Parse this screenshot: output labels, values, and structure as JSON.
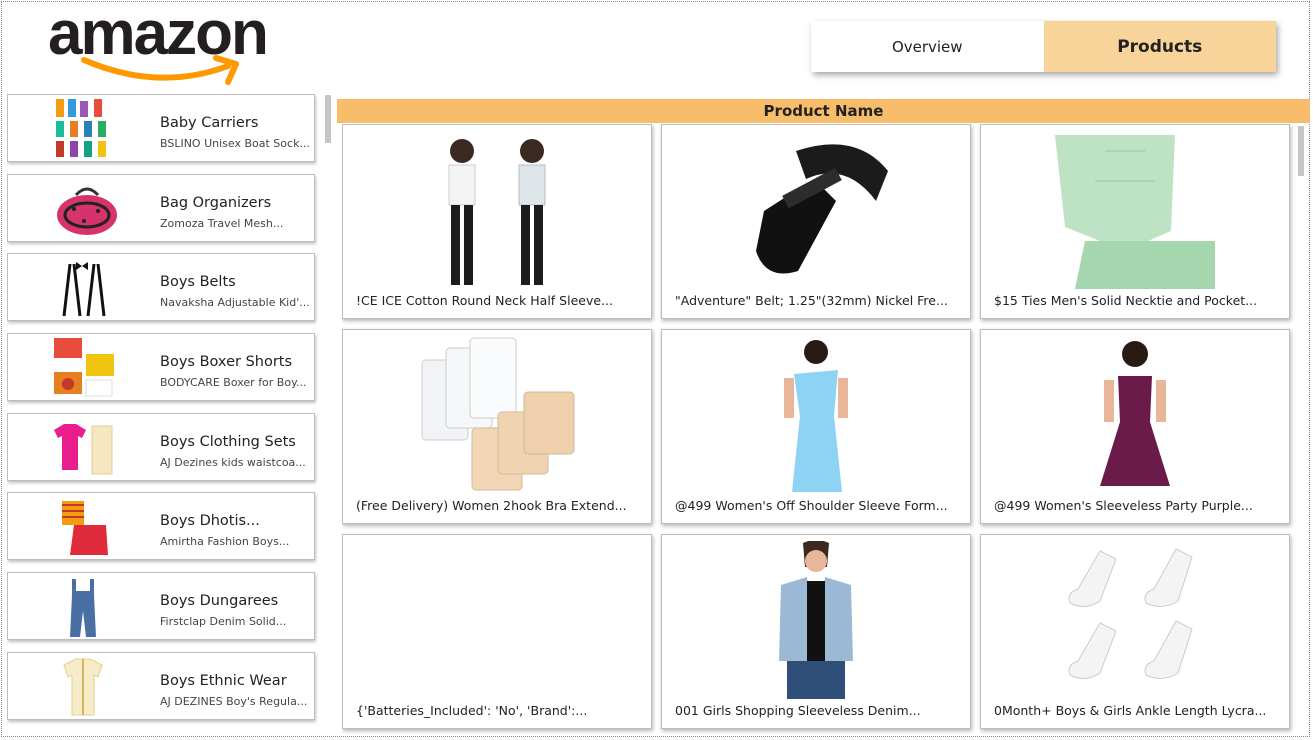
{
  "logo": {
    "text": "amazon"
  },
  "tabs": [
    {
      "label": "Overview",
      "active": false
    },
    {
      "label": "Products",
      "active": true
    }
  ],
  "categories": [
    {
      "title": "Baby Carriers",
      "subtitle": "BSLINO Unisex Boat Sock..."
    },
    {
      "title": "Bag Organizers",
      "subtitle": "Zomoza Travel Mesh..."
    },
    {
      "title": "Boys Belts",
      "subtitle": "Navaksha Adjustable Kid'..."
    },
    {
      "title": "Boys Boxer Shorts",
      "subtitle": "BODYCARE Boxer for Boy..."
    },
    {
      "title": "Boys Clothing Sets",
      "subtitle": "AJ Dezines kids waistcoa..."
    },
    {
      "title": "Boys Dhotis...",
      "subtitle": "Amirtha Fashion Boys..."
    },
    {
      "title": "Boys Dungarees",
      "subtitle": "Firstclap Denim Solid..."
    },
    {
      "title": "Boys Ethnic Wear",
      "subtitle": "AJ DEZINES Boy's Regula..."
    }
  ],
  "products": {
    "header": "Product Name",
    "items": [
      {
        "label": "!CE ICE Cotton Round Neck Half Sleeve..."
      },
      {
        "label": "\"Adventure\" Belt; 1.25\"(32mm) Nickel Fre..."
      },
      {
        "label": "$15 Ties Men's Solid Necktie and Pocket..."
      },
      {
        "label": "(Free Delivery) Women 2hook Bra Extend..."
      },
      {
        "label": "@499 Women's Off Shoulder Sleeve Form..."
      },
      {
        "label": "@499 Women's Sleeveless Party Purple..."
      },
      {
        "label": "{'Batteries_Included': 'No', 'Brand':..."
      },
      {
        "label": "001 Girls Shopping Sleeveless Denim..."
      },
      {
        "label": "0Month+ Boys & Girls Ankle Length Lycra..."
      }
    ]
  },
  "colors": {
    "active_tab": "#f9d49a",
    "header_bar": "#f8bd6a",
    "logo_arrow": "#ff9900"
  }
}
